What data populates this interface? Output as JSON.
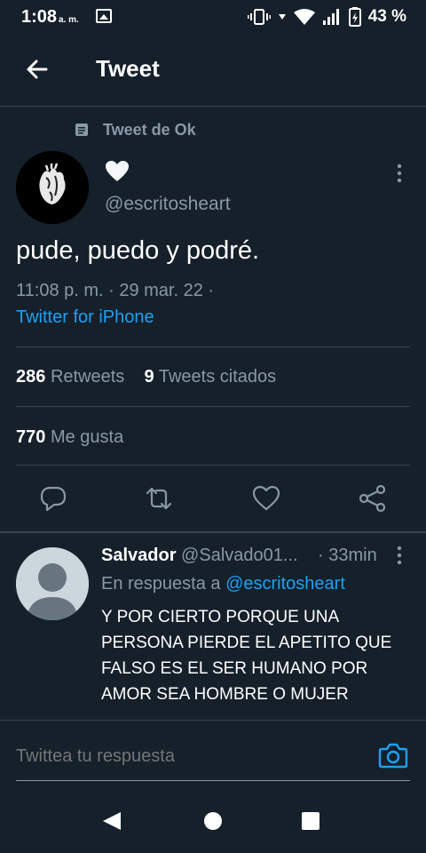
{
  "status_bar": {
    "time": "1:08",
    "ampm": "a. m.",
    "battery": "43 %"
  },
  "header": {
    "title": "Tweet"
  },
  "tweet": {
    "context_label": "Tweet de Ok",
    "display_name_emoji": "heart",
    "handle": "@escritosheart",
    "text": "pude, puedo y podré.",
    "meta": "11:08 p. m. · 29 mar. 22 ·",
    "source": "Twitter for iPhone",
    "retweets_count": "286",
    "retweets_label": "Retweets",
    "quotes_count": "9",
    "quotes_label": "Tweets citados",
    "likes_count": "770",
    "likes_label": "Me gusta"
  },
  "reply": {
    "name": "Salvador",
    "handle": "@Salvado01...",
    "time": "· 33min",
    "in_reply_prefix": "En respuesta a",
    "in_reply_handle": "@escritosheart",
    "text": "Y POR CIERTO PORQUE UNA PERSONA PIERDE EL APETITO QUE FALSO ES EL  SER HUMANO POR AMOR SEA HOMBRE O MUJER"
  },
  "compose": {
    "placeholder": "Twittea tu respuesta"
  },
  "colors": {
    "background": "#15202b",
    "accent": "#1da1f2",
    "muted": "#8899a6",
    "divider": "#38444d"
  }
}
